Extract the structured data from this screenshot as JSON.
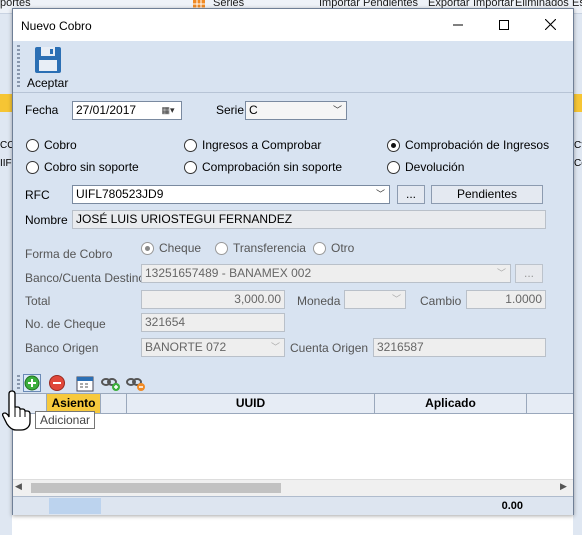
{
  "background_app": {
    "items": [
      "portes",
      "Series",
      "Importar Pendientes",
      "Exportar",
      "Importar",
      "Eliminados",
      "Es"
    ],
    "left_fragments": [
      "CO",
      "IIF"
    ],
    "right_fragments": [
      "Cta",
      "Co"
    ]
  },
  "window": {
    "title": "Nuevo Cobro",
    "minimize": "—",
    "maximize": "☐",
    "close": "✕"
  },
  "toolbar": {
    "accept_label": "Aceptar"
  },
  "form": {
    "fecha_label": "Fecha",
    "fecha_value": "27/01/2017",
    "serie_label": "Serie",
    "serie_value": "C",
    "radios": [
      {
        "label": "Cobro",
        "checked": false
      },
      {
        "label": "Ingresos a Comprobar",
        "checked": false
      },
      {
        "label": "Comprobación de Ingresos",
        "checked": true
      },
      {
        "label": "Cobro sin soporte",
        "checked": false
      },
      {
        "label": "Comprobación sin soporte",
        "checked": false
      },
      {
        "label": "Devolución",
        "checked": false
      }
    ],
    "rfc_label": "RFC",
    "rfc_value": "UIFL780523JD9",
    "ellipsis": "...",
    "pendientes_label": "Pendientes",
    "nombre_label": "Nombre",
    "nombre_value": "JOSÉ LUIS URIOSTEGUI FERNANDEZ",
    "forma_label": "Forma de Cobro",
    "forma_options": [
      {
        "label": "Cheque",
        "checked": true
      },
      {
        "label": "Transferencia",
        "checked": false
      },
      {
        "label": "Otro",
        "checked": false
      }
    ],
    "banco_destino_label": "Banco/Cuenta Destino",
    "banco_destino_value": "13251657489 - BANAMEX  002",
    "total_label": "Total",
    "total_value": "3,000.00",
    "moneda_label": "Moneda",
    "moneda_value": "",
    "cambio_label": "Cambio",
    "cambio_value": "1.0000",
    "cheque_label": "No. de Cheque",
    "cheque_value": "321654",
    "banco_origen_label": "Banco Origen",
    "banco_origen_value": "BANORTE  072",
    "cuenta_origen_label": "Cuenta Origen",
    "cuenta_origen_value": "3216587"
  },
  "grid": {
    "columns": [
      "Asiento",
      "UUID",
      "Aplicado"
    ],
    "total": "0.00"
  },
  "tooltip": "Adicionar",
  "colors": {
    "dialog_bg": "#d8e3f1",
    "header_selected": "#f7c93c",
    "accent_blue": "#2b6fb4"
  }
}
